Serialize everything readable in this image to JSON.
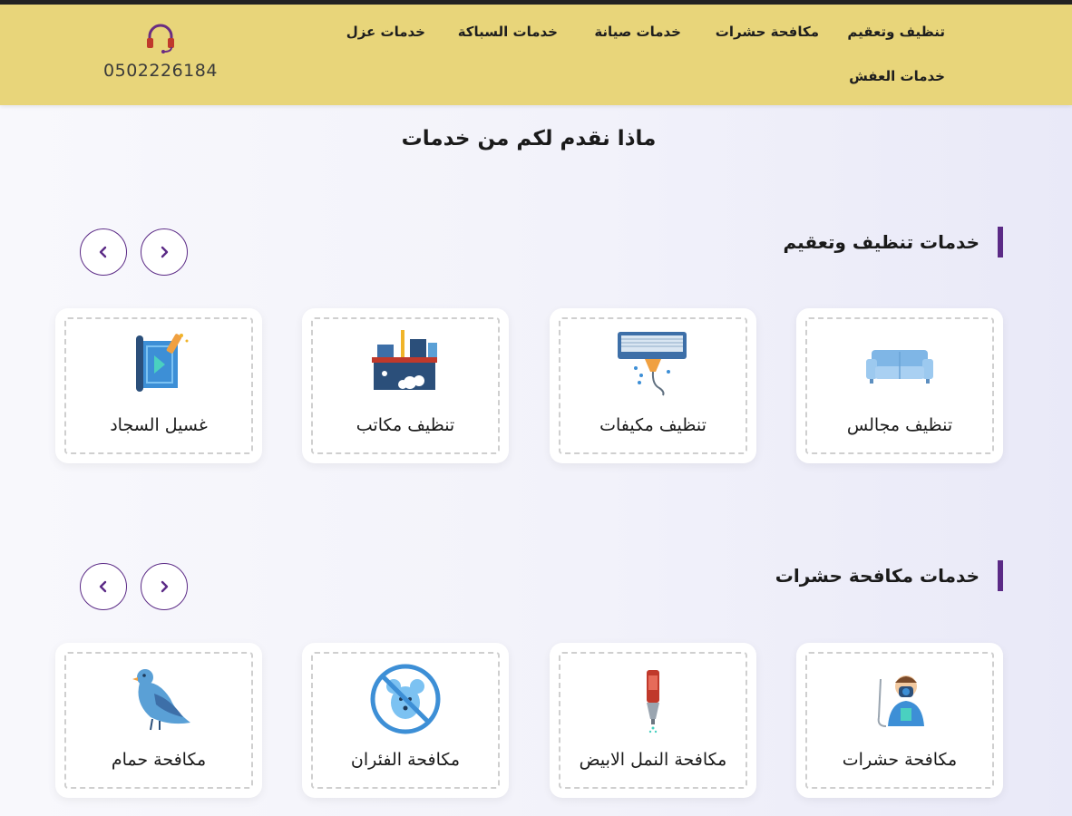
{
  "header": {
    "phone": "0502226184",
    "nav": [
      {
        "label": "تنظيف وتعقيم"
      },
      {
        "label": "مكافحة حشرات"
      },
      {
        "label": "خدمات صيانة"
      },
      {
        "label": "خدمات السباكة"
      },
      {
        "label": "خدمات عزل"
      },
      {
        "label": "خدمات العفش"
      }
    ]
  },
  "page": {
    "title": "ماذا نقدم لكم من خدمات"
  },
  "sections": [
    {
      "title": "خدمات تنظيف وتعقيم",
      "cards": [
        {
          "label": "تنظيف مجالس",
          "icon": "sofa-icon"
        },
        {
          "label": "تنظيف مكيفات",
          "icon": "air-conditioner-icon"
        },
        {
          "label": "تنظيف مكاتب",
          "icon": "office-desk-icon"
        },
        {
          "label": "غسيل السجاد",
          "icon": "carpet-icon"
        }
      ]
    },
    {
      "title": "خدمات مكافحة حشرات",
      "cards": [
        {
          "label": "مكافحة حشرات",
          "icon": "exterminator-icon"
        },
        {
          "label": "مكافحة النمل الابيض",
          "icon": "spray-bottle-icon"
        },
        {
          "label": "مكافحة الفئران",
          "icon": "no-mouse-icon"
        },
        {
          "label": "مكافحة حمام",
          "icon": "pigeon-icon"
        }
      ]
    }
  ],
  "colors": {
    "header_bg": "#e8d57a",
    "accent": "#5b2a86"
  }
}
